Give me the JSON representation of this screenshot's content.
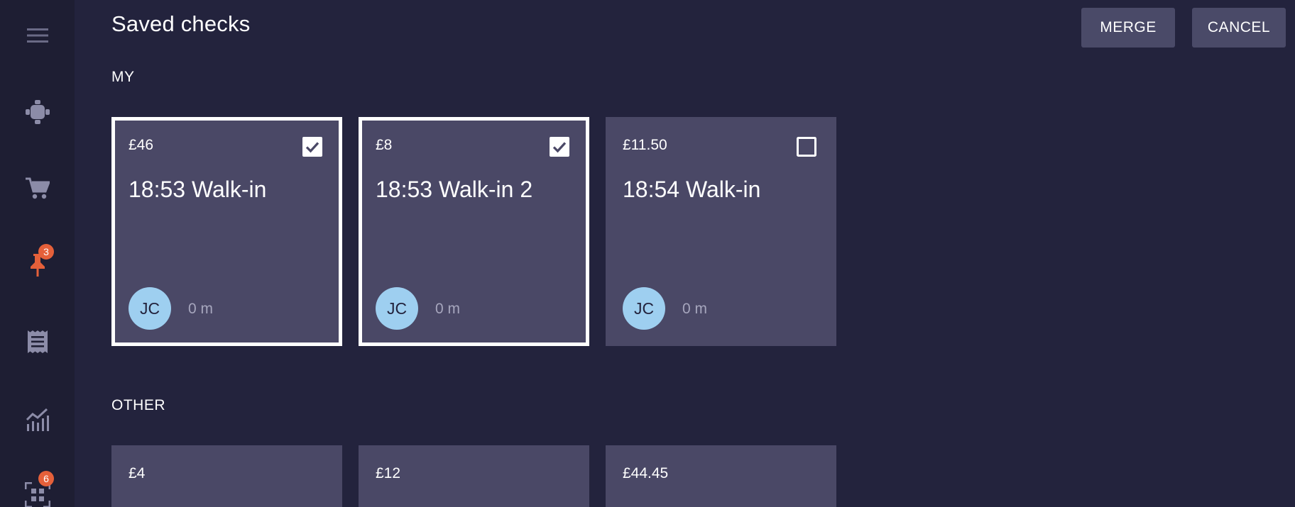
{
  "title": "Saved checks",
  "actions": {
    "merge_label": "MERGE",
    "cancel_label": "CANCEL"
  },
  "sidebar": {
    "items": [
      {
        "icon": "menu-icon",
        "badge": null
      },
      {
        "icon": "table-icon",
        "badge": null
      },
      {
        "icon": "cart-icon",
        "badge": null
      },
      {
        "icon": "pin-icon",
        "badge": "3",
        "active": true
      },
      {
        "icon": "receipt-icon",
        "badge": null
      },
      {
        "icon": "analytics-icon",
        "badge": null
      },
      {
        "icon": "qr-scan-icon",
        "badge": "6"
      }
    ]
  },
  "sections": {
    "my": {
      "label": "MY",
      "cards": [
        {
          "amount": "£46",
          "title": "18:53 Walk-in",
          "initials": "JC",
          "time": "0 m",
          "selected": true
        },
        {
          "amount": "£8",
          "title": "18:53 Walk-in 2",
          "initials": "JC",
          "time": "0 m",
          "selected": true
        },
        {
          "amount": "£11.50",
          "title": "18:54 Walk-in",
          "initials": "JC",
          "time": "0 m",
          "selected": false
        }
      ]
    },
    "other": {
      "label": "OTHER",
      "cards": [
        {
          "amount": "£4"
        },
        {
          "amount": "£12"
        },
        {
          "amount": "£44.45"
        }
      ]
    }
  },
  "colors": {
    "background": "#23233d",
    "sidebar": "#1e1e33",
    "card": "#4a4866",
    "button": "#4a4a68",
    "avatar": "#9ecff0",
    "badge": "#e5603a",
    "active_icon": "#e5603a"
  }
}
